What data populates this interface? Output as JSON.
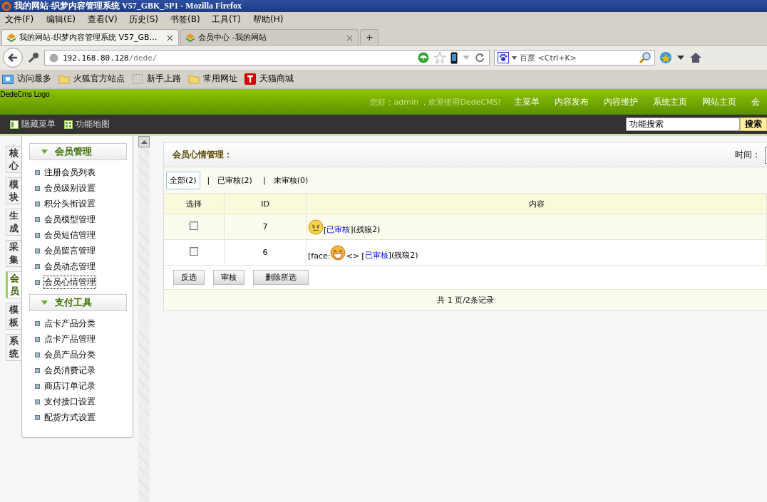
{
  "window": {
    "title": "我的网站-织梦内容管理系统 V57_GBK_SP1 - Mozilla Firefox"
  },
  "menu_bar": [
    "文件(F)",
    "编辑(E)",
    "查看(V)",
    "历史(S)",
    "书签(B)",
    "工具(T)",
    "帮助(H)"
  ],
  "browser_tabs": [
    {
      "label": "我的网站-织梦内容管理系统 V57_GB…",
      "close": "×",
      "selected": true
    },
    {
      "label": "会员中心 -我的网站",
      "close": "×",
      "selected": false
    }
  ],
  "new_tab_button": "+",
  "address_bar": {
    "host": "192.168.80.128",
    "path": "/dede/"
  },
  "search_box": {
    "placeholder": "百度 <Ctrl+K>"
  },
  "bookmarks": [
    {
      "label": "访问最多",
      "kind": "smart"
    },
    {
      "label": "火狐官方站点",
      "kind": "folder"
    },
    {
      "label": "新手上路",
      "kind": "page"
    },
    {
      "label": "常用网址",
      "kind": "folder"
    },
    {
      "label": "天猫商城",
      "kind": "tmall"
    }
  ],
  "header": {
    "logo": "DedeCms Logo",
    "greeting": "您好：admin ，欢迎使用DedeCMS!",
    "nav": [
      "主菜单",
      "内容发布",
      "内容维护",
      "系统主页",
      "网站主页",
      "会"
    ]
  },
  "toolbar": {
    "items": [
      {
        "label": "隐藏菜单",
        "kind": "hide"
      },
      {
        "label": "功能地图",
        "kind": "map"
      }
    ],
    "search_value": "功能搜索",
    "search_button": "搜索"
  },
  "side_tabs": [
    {
      "label": "核心",
      "selected": false
    },
    {
      "label": "模块",
      "selected": false
    },
    {
      "label": "生成",
      "selected": false
    },
    {
      "label": "采集",
      "selected": false
    },
    {
      "label": "会员",
      "selected": true
    },
    {
      "label": "模板",
      "selected": false
    },
    {
      "label": "系统",
      "selected": false
    }
  ],
  "sidebar": {
    "groups": [
      {
        "title": "会员管理",
        "expanded": true,
        "items": [
          {
            "label": "注册会员列表",
            "selected": false
          },
          {
            "label": "会员级别设置",
            "selected": false
          },
          {
            "label": "积分头衔设置",
            "selected": false
          },
          {
            "label": "会员模型管理",
            "selected": false
          },
          {
            "label": "会员短信管理",
            "selected": false
          },
          {
            "label": "会员留言管理",
            "selected": false
          },
          {
            "label": "会员动态管理",
            "selected": false
          },
          {
            "label": "会员心情管理",
            "selected": true
          }
        ]
      },
      {
        "title": "支付工具",
        "expanded": true,
        "items": [
          {
            "label": "点卡产品分类",
            "selected": false
          },
          {
            "label": "点卡产品管理",
            "selected": false
          },
          {
            "label": "会员产品分类",
            "selected": false
          },
          {
            "label": "会员消费记录",
            "selected": false
          },
          {
            "label": "商店订单记录",
            "selected": false
          },
          {
            "label": "支付接口设置",
            "selected": false
          },
          {
            "label": "配货方式设置",
            "selected": false
          }
        ]
      }
    ]
  },
  "main": {
    "title": "会员心情管理：",
    "time_label": "时间：",
    "filters": [
      {
        "label": "全部(2)",
        "selected": true
      },
      {
        "separator": "|",
        "label": "已审核(2)",
        "selected": false
      },
      {
        "separator": "|",
        "label": "未审核(0)",
        "selected": false
      }
    ],
    "table": {
      "columns": [
        "选择",
        "ID",
        "内容"
      ],
      "rows": [
        {
          "checked": false,
          "id": "7",
          "content": [
            {
              "kind": "worried_face"
            },
            {
              "kind": "text",
              "text": "["
            },
            {
              "kind": "link",
              "text": "已审核"
            },
            {
              "kind": "text",
              "text": "](残狼2)"
            }
          ]
        },
        {
          "checked": false,
          "id": "6",
          "content": [
            {
              "kind": "text",
              "text": "[face:"
            },
            {
              "kind": "laughing_face"
            },
            {
              "kind": "text",
              "text": "<> ["
            },
            {
              "kind": "link",
              "text": "已审核"
            },
            {
              "kind": "text",
              "text": "](残狼2)"
            }
          ]
        }
      ]
    },
    "buttons": [
      "反选",
      "审核",
      "删除所选"
    ],
    "pagination": "共 1 页/2条记录"
  }
}
